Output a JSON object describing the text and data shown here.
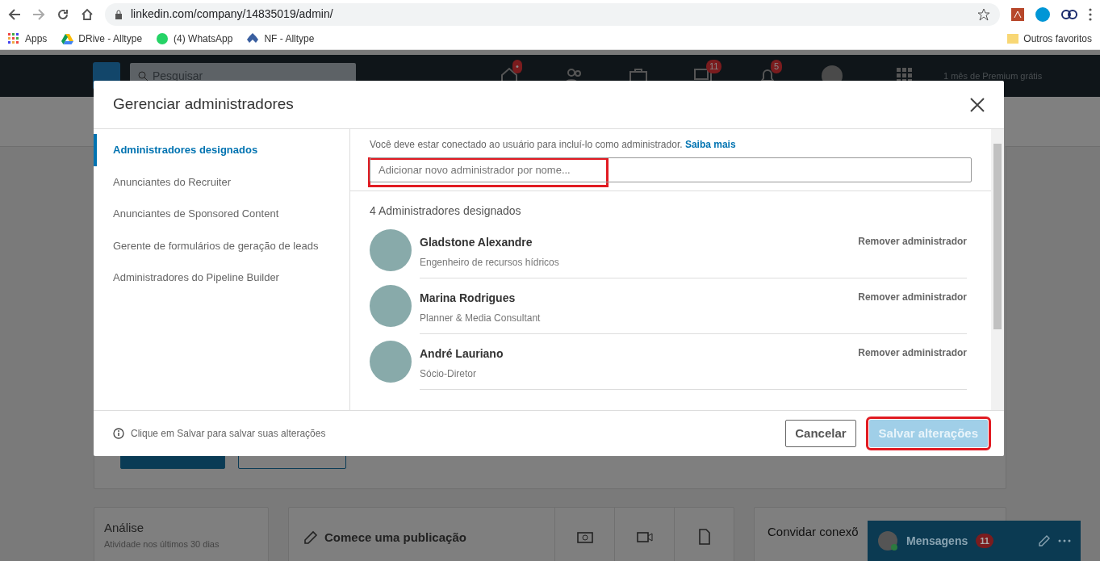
{
  "browser": {
    "url": "linkedin.com/company/14835019/admin/",
    "bookmarks": [
      {
        "label": "Apps"
      },
      {
        "label": "DRive - Alltype"
      },
      {
        "label": "(4) WhatsApp"
      },
      {
        "label": "NF - Alltype"
      }
    ],
    "other_bookmarks": "Outros favoritos"
  },
  "navbar": {
    "search_placeholder": "Pesquisar",
    "home_badge": "•",
    "messages_badge": "11",
    "notifications_badge": "5",
    "premium": "1 mês de Premium grátis"
  },
  "page": {
    "analytics": {
      "title": "Análise",
      "subtitle": "Atividade nos últimos 30 dias"
    },
    "composer": "Comece uma publicação",
    "invite": "Convidar conexõ",
    "messaging": {
      "label": "Mensagens",
      "badge": "11"
    }
  },
  "modal": {
    "title": "Gerenciar administradores",
    "sidebar": [
      {
        "label": "Administradores designados",
        "selected": true
      },
      {
        "label": "Anunciantes do Recruiter",
        "selected": false
      },
      {
        "label": "Anunciantes de Sponsored Content",
        "selected": false
      },
      {
        "label": "Gerente de formulários de geração de leads",
        "selected": false
      },
      {
        "label": "Administradores do Pipeline Builder",
        "selected": false
      }
    ],
    "notice": "Você deve estar conectado ao usuário para incluí-lo como administrador.",
    "notice_link": "Saiba mais",
    "add_placeholder": "Adicionar novo administrador por nome...",
    "count_label": "4 Administradores designados",
    "admins": [
      {
        "name": "Gladstone Alexandre",
        "headline": "Engenheiro de recursos hídricos",
        "action": "Remover administrador"
      },
      {
        "name": "Marina Rodrigues",
        "headline": "Planner & Media Consultant",
        "action": "Remover administrador"
      },
      {
        "name": "André Lauriano",
        "headline": "Sócio-Diretor",
        "action": "Remover administrador"
      }
    ],
    "footer_hint": "Clique em Salvar para salvar suas alterações",
    "cancel": "Cancelar",
    "save": {
      "label": "Salvar alterações",
      "disabled": true
    }
  }
}
